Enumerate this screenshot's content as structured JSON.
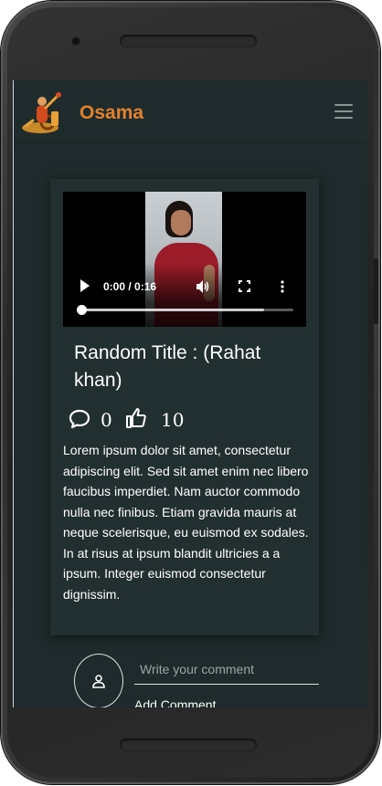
{
  "app": {
    "brand": "Osama",
    "accent_color": "#e2822c",
    "background_color": "#1e2a2b"
  },
  "navbar": {
    "menu_icon": "hamburger-menu-icon",
    "logo": "cyclist-logo"
  },
  "video": {
    "time_display": "0:00 / 0:16",
    "buffered_fraction": 0.86,
    "played_fraction": 0.0
  },
  "post": {
    "title": "Random Title : (Rahat khan)",
    "comments_count": "0",
    "likes_count": "10",
    "body": "Lorem ipsum dolor sit amet, consectetur adipiscing elit. Sed sit amet enim nec libero faucibus imperdiet. Nam auctor commodo nulla nec finibus. Etiam gravida mauris at neque scelerisque, eu euismod ex sodales. In at risus at ipsum blandit ultricies a a ipsum. Integer euismod consectetur dignissim."
  },
  "comment_form": {
    "placeholder": "Write your comment",
    "value": "",
    "submit_label": "Add Comment"
  }
}
